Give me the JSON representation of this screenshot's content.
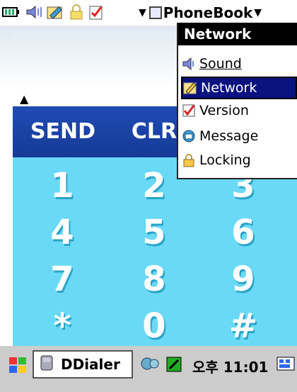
{
  "top_bar": {
    "app_title": "PhoneBook"
  },
  "menu": {
    "header": "Network",
    "items": [
      {
        "label": "Sound",
        "icon": "speaker-icon"
      },
      {
        "label": "Network",
        "icon": "pencil-icon",
        "selected": true
      },
      {
        "label": "Version",
        "icon": "check-icon"
      },
      {
        "label": "Message",
        "icon": "message-icon"
      },
      {
        "label": "Locking",
        "icon": "lock-icon"
      }
    ]
  },
  "keypad": {
    "send": "SEND",
    "clr": "CLR",
    "k1": "1",
    "k2": "2",
    "k3": "3",
    "k4": "4",
    "k5": "5",
    "k6": "6",
    "k7": "7",
    "k8": "8",
    "k9": "9",
    "kstar": "*",
    "k0": "0",
    "khash": "#",
    "colors": {
      "pad": "#6ad9f5",
      "top": "#1f4bb3"
    }
  },
  "taskbar": {
    "app_label": "DDialer",
    "time": "오후 11:01"
  }
}
